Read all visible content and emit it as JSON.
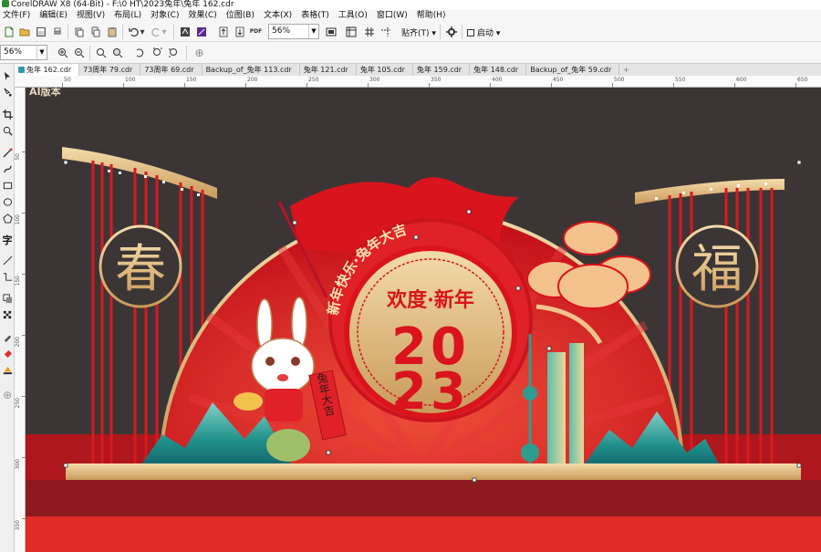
{
  "window": {
    "title": "CorelDRAW X8 (64-Bit) - F:\\0 HT\\2023兔年\\兔年 162.cdr"
  },
  "menu": {
    "items": [
      "文件(F)",
      "编辑(E)",
      "视图(V)",
      "布局(L)",
      "对象(C)",
      "效果(C)",
      "位图(B)",
      "文本(X)",
      "表格(T)",
      "工具(O)",
      "窗口(W)",
      "帮助(H)"
    ]
  },
  "toolbar": {
    "zoom_value": "56%",
    "snap_label": "贴齐(T)",
    "launch_label": "启动"
  },
  "property_bar": {
    "zoom_value": "56%"
  },
  "document_tabs": [
    "兔年 162.cdr",
    "73周年 79.cdr",
    "73周年 69.cdr",
    "Backup_of_兔年 113.cdr",
    "兔年 121.cdr",
    "兔年 105.cdr",
    "兔年 159.cdr",
    "兔年 148.cdr",
    "Backup_of_兔年 59.cdr"
  ],
  "active_tab": 0,
  "ruler": {
    "h_labels": [
      "50",
      "100",
      "150",
      "200",
      "250",
      "300",
      "350",
      "400",
      "450",
      "500",
      "550",
      "600",
      "650"
    ],
    "v_labels": [
      "50",
      "100",
      "150",
      "200",
      "250",
      "300",
      "350"
    ]
  },
  "artwork": {
    "corner_label": "AI版本",
    "left_char": "春",
    "right_char": "福",
    "arc_text": "新年快乐·兔年大吉",
    "headline": "欢度·新年",
    "year_top": "20",
    "year_bottom": "23",
    "scroll_text": "兔年大吉",
    "colors": {
      "canvas": "#3c3535",
      "red": "#d9141c",
      "dark_red": "#8b1a1c",
      "gold": "#e8c88a",
      "teal": "#2a9d93",
      "cloud": "#f4c28c"
    }
  }
}
